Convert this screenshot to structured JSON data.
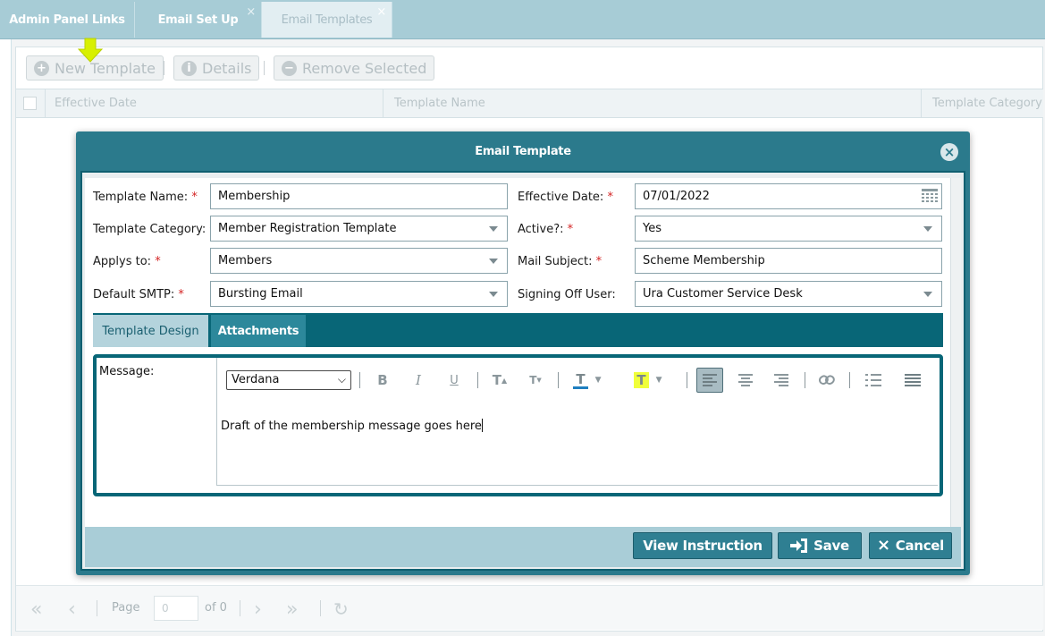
{
  "tabs": [
    {
      "label": "Admin Panel Links",
      "closable": false
    },
    {
      "label": "Email Set Up",
      "closable": true
    },
    {
      "label": "Email Templates",
      "closable": true,
      "active": true
    }
  ],
  "tab_close_glyph": "×",
  "toolbar": {
    "new_template": "New Template",
    "details": "Details",
    "remove_selected": "Remove Selected"
  },
  "grid": {
    "columns": [
      "Effective Date",
      "Template Name",
      "Template Category"
    ]
  },
  "pager": {
    "page_label": "Page",
    "page_value": "0",
    "of_label": "of 0"
  },
  "modal": {
    "title": "Email Template",
    "fields": {
      "template_name": {
        "label": "Template Name:",
        "value": "Membership"
      },
      "effective_date": {
        "label": "Effective Date:",
        "value": "07/01/2022"
      },
      "template_category": {
        "label": "Template Category:",
        "value": "Member Registration Template"
      },
      "active": {
        "label": "Active?:",
        "value": "Yes"
      },
      "applys_to": {
        "label": "Applys to:",
        "value": "Members"
      },
      "mail_subject": {
        "label": "Mail Subject:",
        "value": "Scheme Membership"
      },
      "default_smtp": {
        "label": "Default SMTP:",
        "value": "Bursting Email"
      },
      "signing_off_user": {
        "label": "Signing Off User:",
        "value": "Ura Customer Service Desk"
      }
    },
    "required_marker": "*",
    "subtabs": [
      "Template Design",
      "Attachments"
    ],
    "message_label": "Message:",
    "editor": {
      "font": "Verdana",
      "content": "Draft of the membership message goes here"
    },
    "buttons": {
      "view_instruction": "View Instruction",
      "save": "Save",
      "cancel": "Cancel"
    }
  },
  "colors": {
    "modal_header": "#2b7a8c",
    "tabs_strip": "#086677",
    "required": "#d42424",
    "marker_arrow": "#d8f000"
  }
}
